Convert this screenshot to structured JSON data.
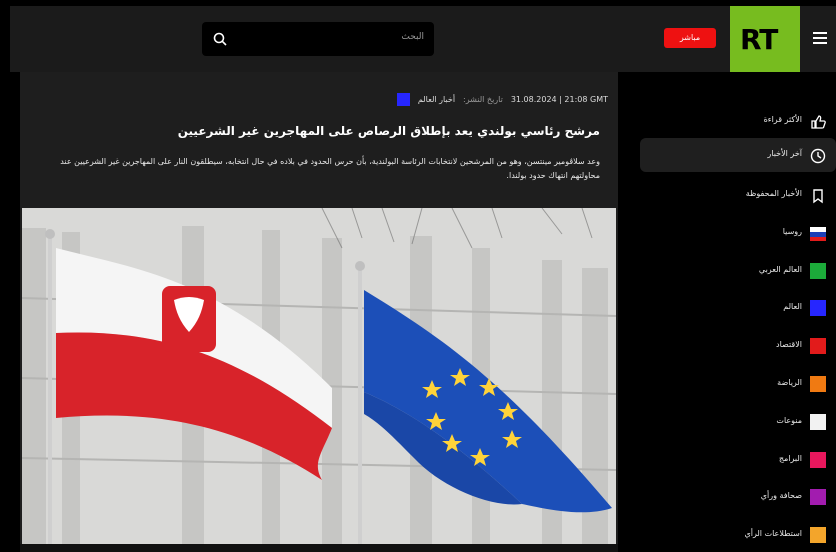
{
  "header": {
    "search_placeholder": "البحث",
    "live_label": "مباشر",
    "logo_text": "RT"
  },
  "article": {
    "category": "أخبار العالم",
    "date_label": "تاريخ النشر:",
    "date_value": "31.08.2024 | 21:08 GMT",
    "headline": "مرشح رئاسي بولندي يعد بإطلاق الرصاص على المهاجرين غير الشرعيين",
    "lead": "وعد سلاڤومير مينتسن، وهو من المرشحين لانتخابات الرئاسة البولندية، بأن حرس الحدود في بلاده في حال انتخابه، سيطلقون النار على المهاجرين غير الشرعيين عند محاولتهم انتهاك حدود بولندا."
  },
  "sidebar": {
    "items": [
      {
        "label": "الأكثر قراءة",
        "icon": "thumbs-up-icon"
      },
      {
        "label": "آخر الأخبار",
        "icon": "clock-icon"
      },
      {
        "label": "الأخبار المحفوظة",
        "icon": "bookmark-icon"
      },
      {
        "label": "روسيا",
        "icon": "russia-flag-icon"
      },
      {
        "label": "العالم العربي",
        "color": "#1cab3a"
      },
      {
        "label": "العالم",
        "color": "#2626ff"
      },
      {
        "label": "الاقتصاد",
        "color": "#e21b1b"
      },
      {
        "label": "الرياضة",
        "color": "#f07a12"
      },
      {
        "label": "منوعات",
        "color": "#f2f2f2"
      },
      {
        "label": "البرامج",
        "color": "#e8175d"
      },
      {
        "label": "صحافة ورأي",
        "color": "#a21caf"
      },
      {
        "label": "استطلاعات الرأي",
        "color": "#f3a52b"
      }
    ]
  },
  "colors": {
    "brand_green": "#77bc1f",
    "live_red": "#ee1111"
  }
}
